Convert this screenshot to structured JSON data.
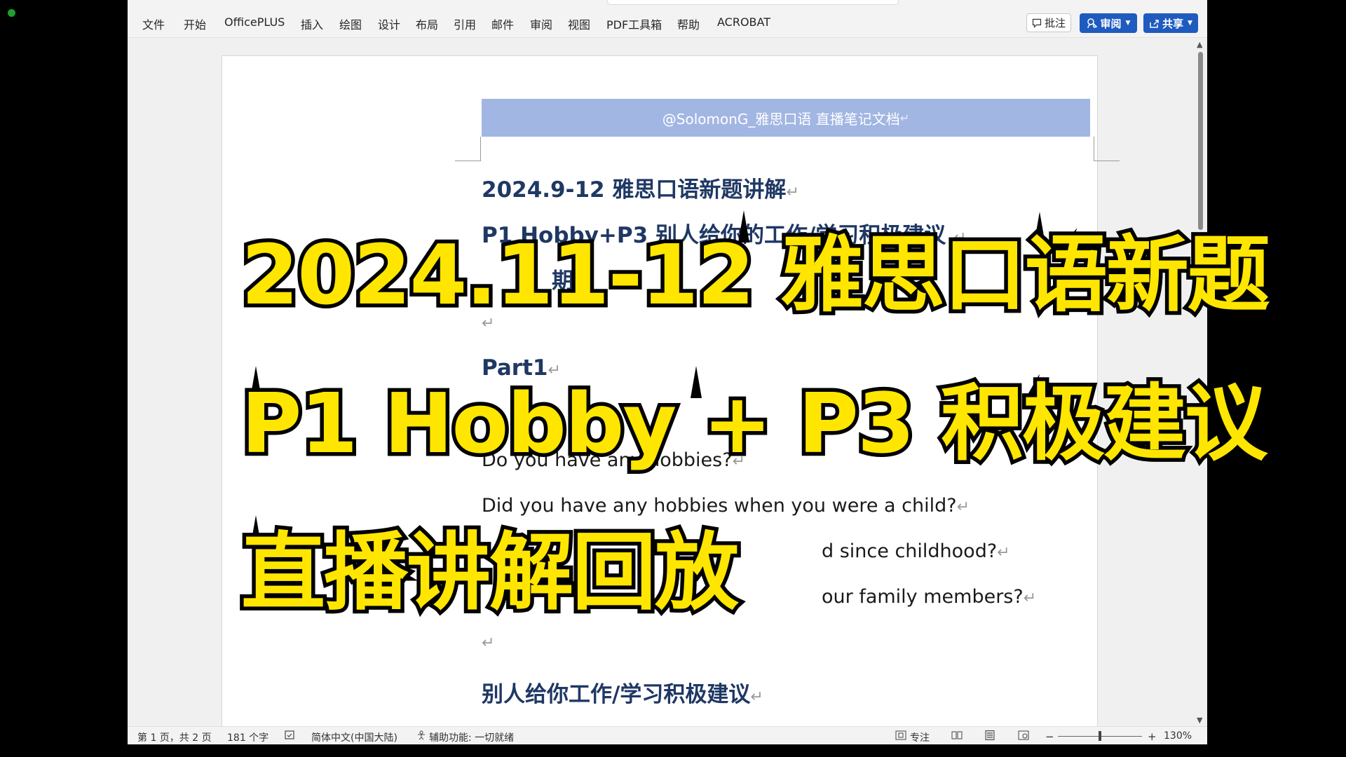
{
  "ribbon": {
    "menu": [
      "文件",
      "开始",
      "OfficePLUS",
      "插入",
      "绘图",
      "设计",
      "布局",
      "引用",
      "邮件",
      "审阅",
      "视图",
      "PDF工具箱",
      "帮助",
      "ACROBAT"
    ],
    "comment_label": "批注",
    "review_label": "审阅",
    "share_label": "共享"
  },
  "document": {
    "header_text": "@SolomonG_雅思口语  直播笔记文档",
    "title": "2024.9-12  雅思口语新题讲解",
    "subtitle": "P1 Hobby+P3  别人给你的工作/学习积极建议",
    "third_line": "期",
    "part_label": "Part1",
    "questions": [
      "Do you have any hobbies?",
      "Did you have any hobbies when you were a child?",
      "d since childhood?",
      "our family members?"
    ],
    "section_heading": "别人给你工作/学习积极建议",
    "paragraph_mark": "↵"
  },
  "status": {
    "page_info": "第 1 页，共 2 页",
    "word_count": "181 个字",
    "language": "简体中文(中国大陆)",
    "accessibility": "辅助功能: 一切就绪",
    "focus_label": "专注",
    "zoom": "130%"
  },
  "overlay": {
    "line1": "2024.11-12 雅思口语新题",
    "line2": "P1 Hobby + P3 积极建议",
    "line3": "直播讲解回放"
  }
}
